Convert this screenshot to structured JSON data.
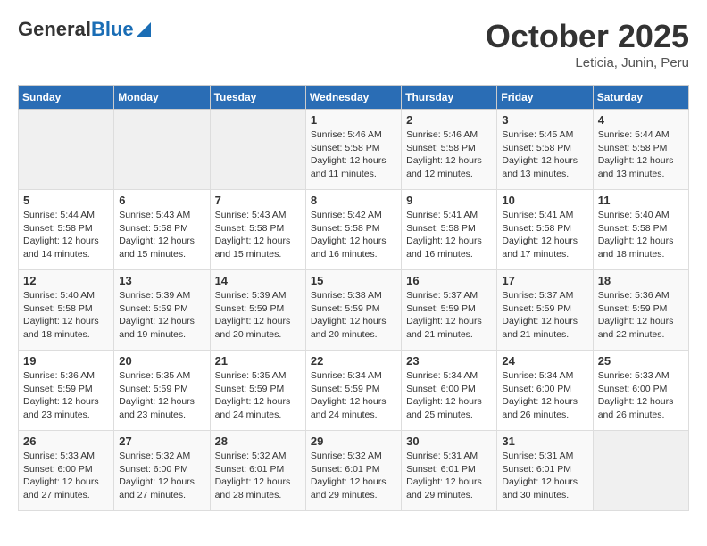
{
  "header": {
    "logo_general": "General",
    "logo_blue": "Blue",
    "month_title": "October 2025",
    "location": "Leticia, Junin, Peru"
  },
  "calendar": {
    "days_of_week": [
      "Sunday",
      "Monday",
      "Tuesday",
      "Wednesday",
      "Thursday",
      "Friday",
      "Saturday"
    ],
    "weeks": [
      [
        {
          "day": "",
          "info": ""
        },
        {
          "day": "",
          "info": ""
        },
        {
          "day": "",
          "info": ""
        },
        {
          "day": "1",
          "info": "Sunrise: 5:46 AM\nSunset: 5:58 PM\nDaylight: 12 hours\nand 11 minutes."
        },
        {
          "day": "2",
          "info": "Sunrise: 5:46 AM\nSunset: 5:58 PM\nDaylight: 12 hours\nand 12 minutes."
        },
        {
          "day": "3",
          "info": "Sunrise: 5:45 AM\nSunset: 5:58 PM\nDaylight: 12 hours\nand 13 minutes."
        },
        {
          "day": "4",
          "info": "Sunrise: 5:44 AM\nSunset: 5:58 PM\nDaylight: 12 hours\nand 13 minutes."
        }
      ],
      [
        {
          "day": "5",
          "info": "Sunrise: 5:44 AM\nSunset: 5:58 PM\nDaylight: 12 hours\nand 14 minutes."
        },
        {
          "day": "6",
          "info": "Sunrise: 5:43 AM\nSunset: 5:58 PM\nDaylight: 12 hours\nand 15 minutes."
        },
        {
          "day": "7",
          "info": "Sunrise: 5:43 AM\nSunset: 5:58 PM\nDaylight: 12 hours\nand 15 minutes."
        },
        {
          "day": "8",
          "info": "Sunrise: 5:42 AM\nSunset: 5:58 PM\nDaylight: 12 hours\nand 16 minutes."
        },
        {
          "day": "9",
          "info": "Sunrise: 5:41 AM\nSunset: 5:58 PM\nDaylight: 12 hours\nand 16 minutes."
        },
        {
          "day": "10",
          "info": "Sunrise: 5:41 AM\nSunset: 5:58 PM\nDaylight: 12 hours\nand 17 minutes."
        },
        {
          "day": "11",
          "info": "Sunrise: 5:40 AM\nSunset: 5:58 PM\nDaylight: 12 hours\nand 18 minutes."
        }
      ],
      [
        {
          "day": "12",
          "info": "Sunrise: 5:40 AM\nSunset: 5:58 PM\nDaylight: 12 hours\nand 18 minutes."
        },
        {
          "day": "13",
          "info": "Sunrise: 5:39 AM\nSunset: 5:59 PM\nDaylight: 12 hours\nand 19 minutes."
        },
        {
          "day": "14",
          "info": "Sunrise: 5:39 AM\nSunset: 5:59 PM\nDaylight: 12 hours\nand 20 minutes."
        },
        {
          "day": "15",
          "info": "Sunrise: 5:38 AM\nSunset: 5:59 PM\nDaylight: 12 hours\nand 20 minutes."
        },
        {
          "day": "16",
          "info": "Sunrise: 5:37 AM\nSunset: 5:59 PM\nDaylight: 12 hours\nand 21 minutes."
        },
        {
          "day": "17",
          "info": "Sunrise: 5:37 AM\nSunset: 5:59 PM\nDaylight: 12 hours\nand 21 minutes."
        },
        {
          "day": "18",
          "info": "Sunrise: 5:36 AM\nSunset: 5:59 PM\nDaylight: 12 hours\nand 22 minutes."
        }
      ],
      [
        {
          "day": "19",
          "info": "Sunrise: 5:36 AM\nSunset: 5:59 PM\nDaylight: 12 hours\nand 23 minutes."
        },
        {
          "day": "20",
          "info": "Sunrise: 5:35 AM\nSunset: 5:59 PM\nDaylight: 12 hours\nand 23 minutes."
        },
        {
          "day": "21",
          "info": "Sunrise: 5:35 AM\nSunset: 5:59 PM\nDaylight: 12 hours\nand 24 minutes."
        },
        {
          "day": "22",
          "info": "Sunrise: 5:34 AM\nSunset: 5:59 PM\nDaylight: 12 hours\nand 24 minutes."
        },
        {
          "day": "23",
          "info": "Sunrise: 5:34 AM\nSunset: 6:00 PM\nDaylight: 12 hours\nand 25 minutes."
        },
        {
          "day": "24",
          "info": "Sunrise: 5:34 AM\nSunset: 6:00 PM\nDaylight: 12 hours\nand 26 minutes."
        },
        {
          "day": "25",
          "info": "Sunrise: 5:33 AM\nSunset: 6:00 PM\nDaylight: 12 hours\nand 26 minutes."
        }
      ],
      [
        {
          "day": "26",
          "info": "Sunrise: 5:33 AM\nSunset: 6:00 PM\nDaylight: 12 hours\nand 27 minutes."
        },
        {
          "day": "27",
          "info": "Sunrise: 5:32 AM\nSunset: 6:00 PM\nDaylight: 12 hours\nand 27 minutes."
        },
        {
          "day": "28",
          "info": "Sunrise: 5:32 AM\nSunset: 6:01 PM\nDaylight: 12 hours\nand 28 minutes."
        },
        {
          "day": "29",
          "info": "Sunrise: 5:32 AM\nSunset: 6:01 PM\nDaylight: 12 hours\nand 29 minutes."
        },
        {
          "day": "30",
          "info": "Sunrise: 5:31 AM\nSunset: 6:01 PM\nDaylight: 12 hours\nand 29 minutes."
        },
        {
          "day": "31",
          "info": "Sunrise: 5:31 AM\nSunset: 6:01 PM\nDaylight: 12 hours\nand 30 minutes."
        },
        {
          "day": "",
          "info": ""
        }
      ]
    ]
  }
}
